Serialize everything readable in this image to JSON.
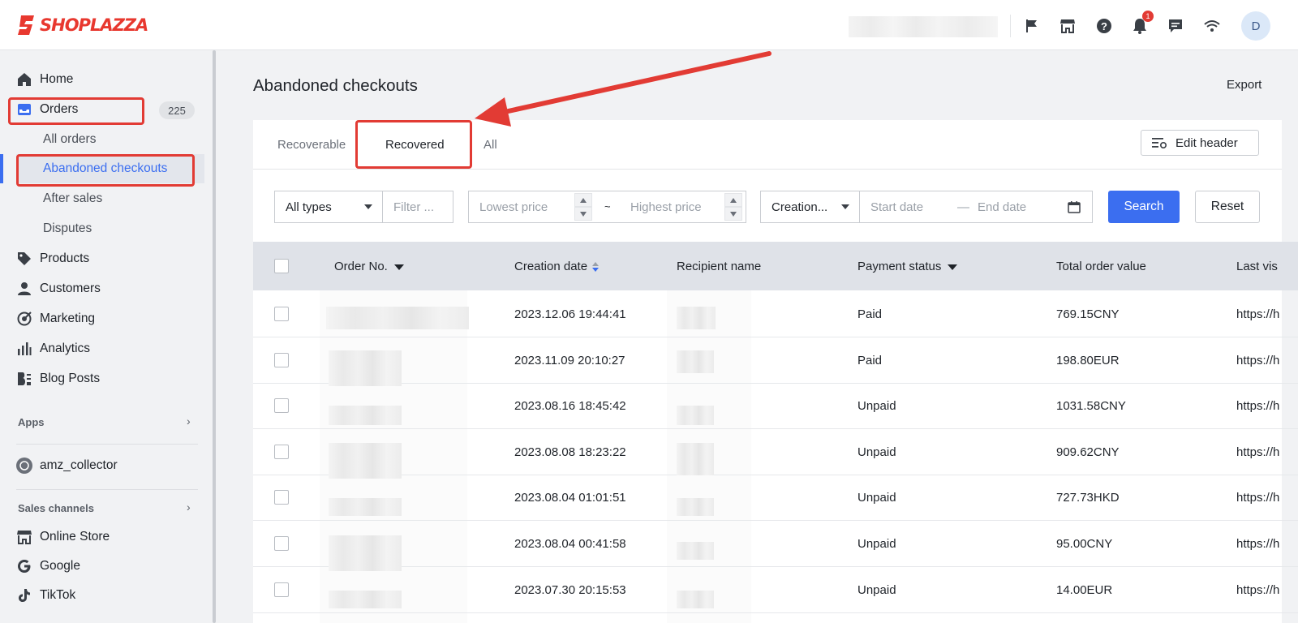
{
  "brand": {
    "name": "SHOPLAZZA",
    "color": "#e8382f"
  },
  "topbar": {
    "icons": [
      "flag-icon",
      "store-icon",
      "help-icon",
      "bell-icon",
      "chat-icon",
      "wifi-icon"
    ],
    "notification_count": "1",
    "avatar_initial": "D"
  },
  "sidebar": {
    "items": [
      {
        "label": "Home",
        "icon": "home-icon"
      },
      {
        "label": "Orders",
        "icon": "inbox-icon",
        "badge": "225"
      },
      {
        "label": "Products",
        "icon": "tag-icon"
      },
      {
        "label": "Customers",
        "icon": "person-icon"
      },
      {
        "label": "Marketing",
        "icon": "target-icon"
      },
      {
        "label": "Analytics",
        "icon": "bar-chart-icon"
      },
      {
        "label": "Blog Posts",
        "icon": "blog-icon"
      }
    ],
    "orders_sub": [
      "All orders",
      "Abandoned checkouts",
      "After sales",
      "Disputes"
    ],
    "apps_heading": "Apps",
    "app_item": "amz_collector",
    "sales_heading": "Sales channels",
    "channels": [
      "Online Store",
      "Google",
      "TikTok"
    ],
    "accent": "#3b6ef0"
  },
  "main": {
    "title": "Abandoned checkouts",
    "export_label": "Export",
    "tabs": [
      "Recoverable",
      "Recovered",
      "All"
    ],
    "active_tab": "Recovered",
    "edit_header_label": "Edit header",
    "filters": {
      "type_value": "All types",
      "filter_placeholder": "Filter ...",
      "lowest_price_placeholder": "Lowest price",
      "range_sep": "~",
      "highest_price_placeholder": "Highest price",
      "date_type_value": "Creation...",
      "start_date_placeholder": "Start date",
      "date_sep": "—",
      "end_date_placeholder": "End date",
      "search_label": "Search",
      "reset_label": "Reset"
    },
    "table": {
      "columns": [
        "Order No.",
        "Creation date",
        "Recipient name",
        "Payment status",
        "Total order value",
        "Last vis"
      ],
      "rows": [
        {
          "date": "2023.12.06 19:44:41",
          "status": "Paid",
          "total": "769.15CNY",
          "url": "https://h"
        },
        {
          "date": "2023.11.09 20:10:27",
          "status": "Paid",
          "total": "198.80EUR",
          "url": "https://h"
        },
        {
          "date": "2023.08.16 18:45:42",
          "status": "Unpaid",
          "total": "1031.58CNY",
          "url": "https://h"
        },
        {
          "date": "2023.08.08 18:23:22",
          "status": "Unpaid",
          "total": "909.62CNY",
          "url": "https://h"
        },
        {
          "date": "2023.08.04 01:01:51",
          "status": "Unpaid",
          "total": "727.73HKD",
          "url": "https://h"
        },
        {
          "date": "2023.08.04 00:41:58",
          "status": "Unpaid",
          "total": "95.00CNY",
          "url": "https://h"
        },
        {
          "date": "2023.07.30 20:15:53",
          "status": "Unpaid",
          "total": "14.00EUR",
          "url": "https://h"
        }
      ]
    }
  },
  "annotation_color": "#e23b34"
}
